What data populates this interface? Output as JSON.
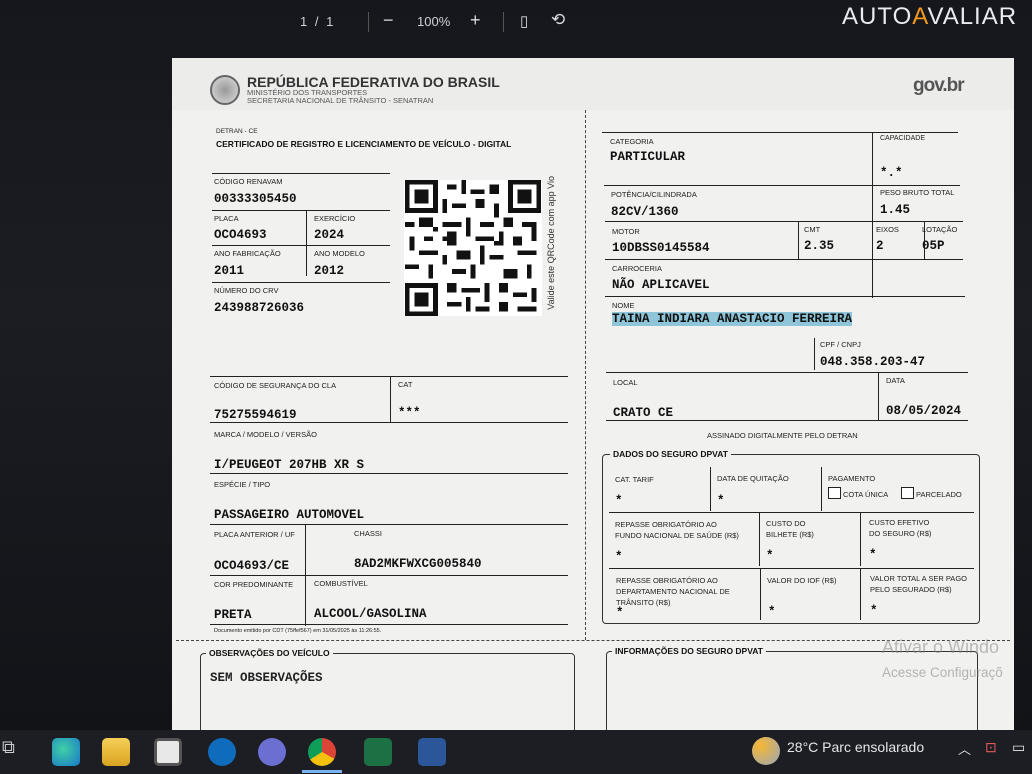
{
  "viewer": {
    "page_indicator": "1 / 1",
    "zoom": "100%",
    "zoom_out_icon": "minus-icon",
    "zoom_in_icon": "plus-icon",
    "fit_icon": "fit-page-icon",
    "rotate_icon": "rotate-icon"
  },
  "watermark": {
    "prefix": "AUTO",
    "highlight": "A",
    "suffix": "VALIAR"
  },
  "header": {
    "republic": "REPÚBLICA FEDERATIVA DO BRASIL",
    "ministry": "MINISTÉRIO DOS TRANSPORTES",
    "secretariat": "SECRETARIA NACIONAL DE TRÂNSITO - SENATRAN",
    "govbr": "gov.br"
  },
  "doc": {
    "detran": "DETRAN - CE",
    "title": "CERTIFICADO DE REGISTRO E LICENCIAMENTO DE VEÍCULO - DIGITAL",
    "qr_caption": "Valide este QRCode com app Vio",
    "renavam_label": "CÓDIGO RENAVAM",
    "renavam": "00333305450",
    "placa_label": "PLACA",
    "placa": "OCO4693",
    "exercicio_label": "EXERCÍCIO",
    "exercicio": "2024",
    "ano_fab_label": "ANO FABRICAÇÃO",
    "ano_fab": "2011",
    "ano_mod_label": "ANO MODELO",
    "ano_mod": "2012",
    "crv_label": "NÚMERO DO CRV",
    "crv": "243988726036",
    "cla_label": "CÓDIGO DE SEGURANÇA DO CLA",
    "cla": "75275594619",
    "cat_label": "CAT",
    "cat": "***",
    "marca_label": "MARCA / MODELO / VERSÃO",
    "marca": "I/PEUGEOT 207HB XR S",
    "especie_label": "ESPÉCIE / TIPO",
    "especie": "PASSAGEIRO AUTOMOVEL",
    "placa_ant_label": "PLACA ANTERIOR / UF",
    "placa_ant": "OCO4693/CE",
    "chassi_label": "CHASSI",
    "chassi": "8AD2MKFWXCG005840",
    "cor_label": "COR PREDOMINANTE",
    "cor": "PRETA",
    "comb_label": "COMBUSTÍVEL",
    "comb": "ALCOOL/GASOLINA",
    "emitido": "Documento emitido por CDT (75ffef567) em 31/05/2025 às 11:26:55.",
    "categoria_label": "CATEGORIA",
    "categoria": "PARTICULAR",
    "capacidade_label": "CAPACIDADE",
    "capacidade": "*.*",
    "potencia_label": "POTÊNCIA/CILINDRADA",
    "potencia": "82CV/1360",
    "peso_label": "PESO BRUTO TOTAL",
    "peso": "1.45",
    "motor_label": "MOTOR",
    "motor": "10DBSS0145584",
    "cmt_label": "CMT",
    "cmt": "2.35",
    "eixos_label": "EIXOS",
    "eixos": "2",
    "lotacao_label": "LOTAÇÃO",
    "lotacao": "05P",
    "carroceria_label": "CARROCERIA",
    "carroceria": "NÃO APLICAVEL",
    "nome_label": "NOME",
    "nome": "TAINA INDIARA ANASTACIO FERREIRA",
    "cpf_label": "CPF / CNPJ",
    "cpf": "048.358.203-47",
    "local_label": "LOCAL",
    "local": "CRATO CE",
    "data_label": "DATA",
    "data": "08/05/2024",
    "assinado": "ASSINADO DIGITALMENTE PELO DETRAN"
  },
  "dpvat": {
    "title": "DADOS DO SEGURO DPVAT",
    "cat_tarif": "CAT. TARIF",
    "data_quitacao": "DATA DE QUITAÇÃO",
    "pagamento": "PAGAMENTO",
    "cota_unica": "COTA ÚNICA",
    "parcelado": "PARCELADO",
    "repasse_saude_1": "REPASSE OBRIGATÓRIO AO",
    "repasse_saude_2": "FUNDO NACIONAL DE SAÚDE (R$)",
    "custo_bilhete_1": "CUSTO DO",
    "custo_bilhete_2": "BILHETE (R$)",
    "custo_efetivo_1": "CUSTO EFETIVO",
    "custo_efetivo_2": "DO SEGURO (R$)",
    "repasse_transito_1": "REPASSE OBRIGATÓRIO AO",
    "repasse_transito_2": "DEPARTAMENTO NACIONAL DE",
    "repasse_transito_3": "TRÂNSITO (R$)",
    "valor_iof": "VALOR DO IOF (R$)",
    "valor_total_1": "VALOR TOTAL A SER PAGO",
    "valor_total_2": "PELO SEGURADO (R$)",
    "star": "*"
  },
  "obs": {
    "title": "OBSERVAÇÕES DO VEÍCULO",
    "text": "SEM OBSERVAÇÕES"
  },
  "info": {
    "title": "INFORMAÇÕES DO SEGURO DPVAT"
  },
  "windows": {
    "activate": "Ativar o Windo",
    "settings": "Acesse Configuraçõ"
  },
  "taskbar": {
    "weather": "28°C  Parc ensolarado",
    "apps": [
      "task-view-icon",
      "edge-icon",
      "file-explorer-icon",
      "store-icon",
      "outlook-icon",
      "teams-icon",
      "chrome-icon",
      "excel-icon",
      "word-icon"
    ]
  }
}
